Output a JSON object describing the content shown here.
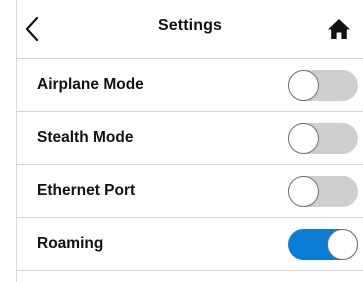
{
  "header": {
    "title": "Settings",
    "back_icon": "chevron-left-icon",
    "home_icon": "home-icon"
  },
  "settings": [
    {
      "label": "Airplane Mode",
      "enabled": false
    },
    {
      "label": "Stealth Mode",
      "enabled": false
    },
    {
      "label": "Ethernet Port",
      "enabled": false
    },
    {
      "label": "Roaming",
      "enabled": true
    }
  ],
  "colors": {
    "toggle_on": "#0c7cd5",
    "toggle_off": "#cfcfcf",
    "divider": "#d6d6d6"
  }
}
